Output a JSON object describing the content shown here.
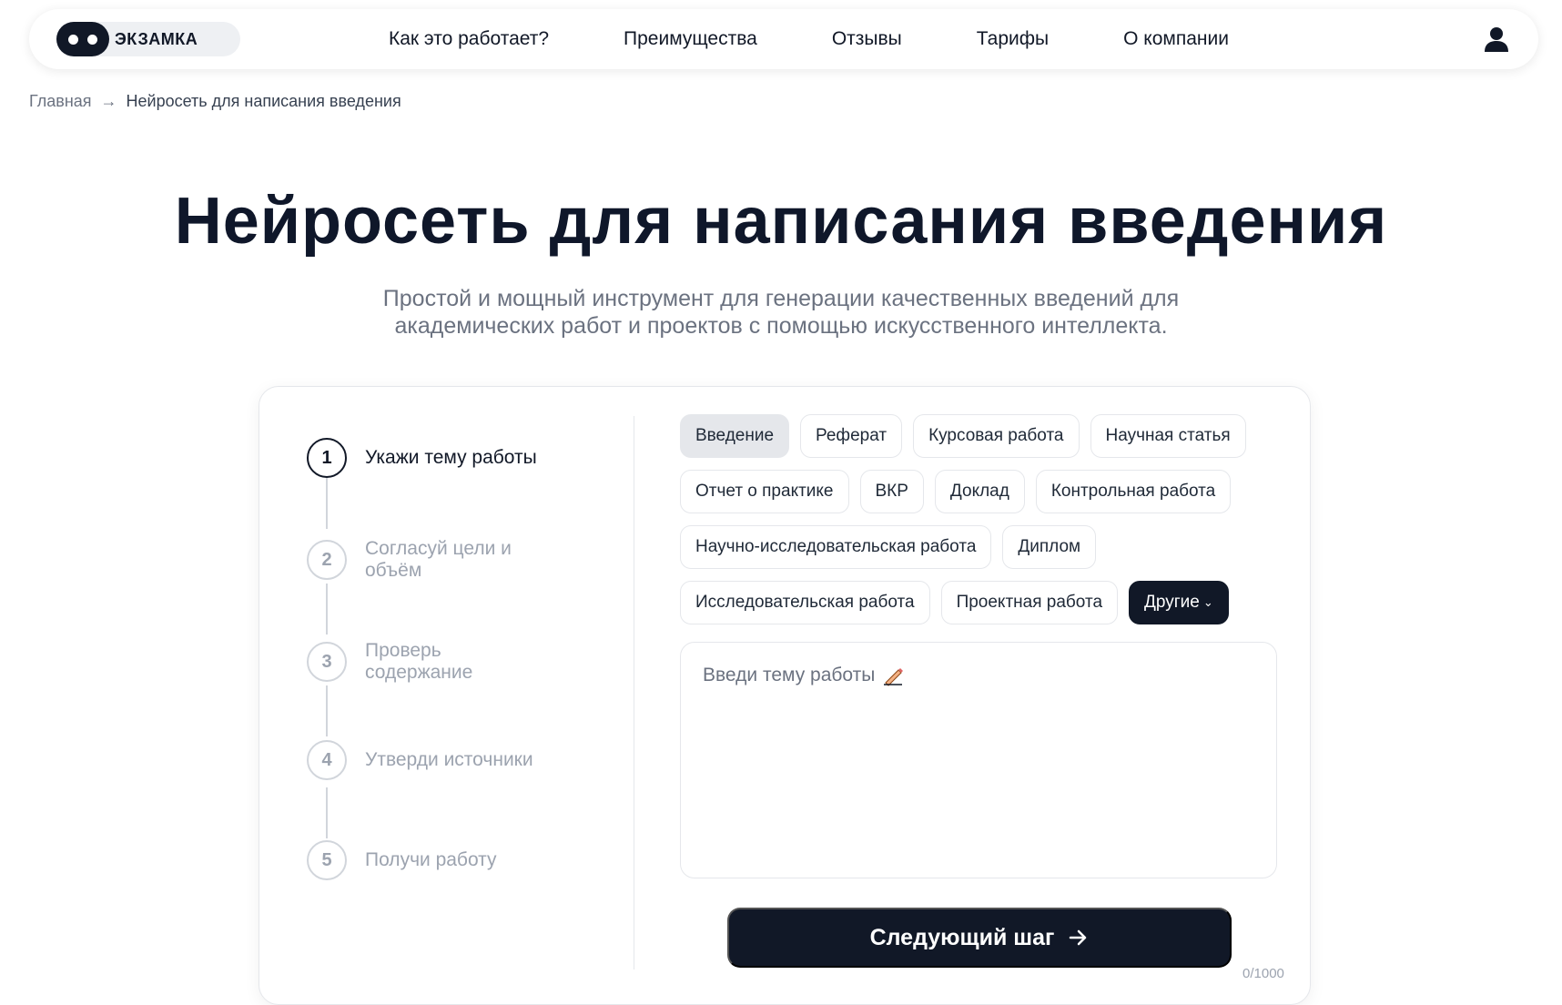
{
  "header": {
    "logo_text": "ЭКЗАМКА",
    "nav": [
      {
        "label": "Как это работает?"
      },
      {
        "label": "Преимущества"
      },
      {
        "label": "Отзывы"
      },
      {
        "label": "Тарифы"
      },
      {
        "label": "О компании"
      }
    ],
    "user_icon": "user-icon"
  },
  "breadcrumb": {
    "home": "Главная",
    "separator": "→",
    "current": "Нейросеть для написания введения"
  },
  "hero": {
    "title": "Нейросеть для написания введения",
    "subtitle": "Простой и мощный инструмент для генерации качественных введений для академических работ и проектов с помощью искусственного интеллекта."
  },
  "steps": [
    {
      "number": "1",
      "label": "Укажи тему работы",
      "active": true
    },
    {
      "number": "2",
      "label": "Согласуй цели и объём",
      "active": false
    },
    {
      "number": "3",
      "label": "Проверь содержание",
      "active": false
    },
    {
      "number": "4",
      "label": "Утверди источники",
      "active": false
    },
    {
      "number": "5",
      "label": "Получи работу",
      "active": false
    }
  ],
  "work_types": {
    "rows": [
      [
        "Введение",
        "Реферат",
        "Курсовая работа",
        "Научная статья"
      ],
      [
        "Отчет о практике",
        "ВКР",
        "Доклад",
        "Контрольная работа"
      ],
      [
        "Научно-исследовательская работа",
        "Диплом"
      ],
      [
        "Исследовательская работа",
        "Проектная работа"
      ]
    ],
    "selected": "Введение",
    "more_label": "Другие"
  },
  "topic": {
    "placeholder": "Введи тему работы",
    "value": "",
    "counter": "0/1000"
  },
  "next_button": {
    "label": "Следующий шаг"
  },
  "colors": {
    "primary_dark": "#111827",
    "muted": "#6b7280",
    "border": "#e5e7eb"
  }
}
